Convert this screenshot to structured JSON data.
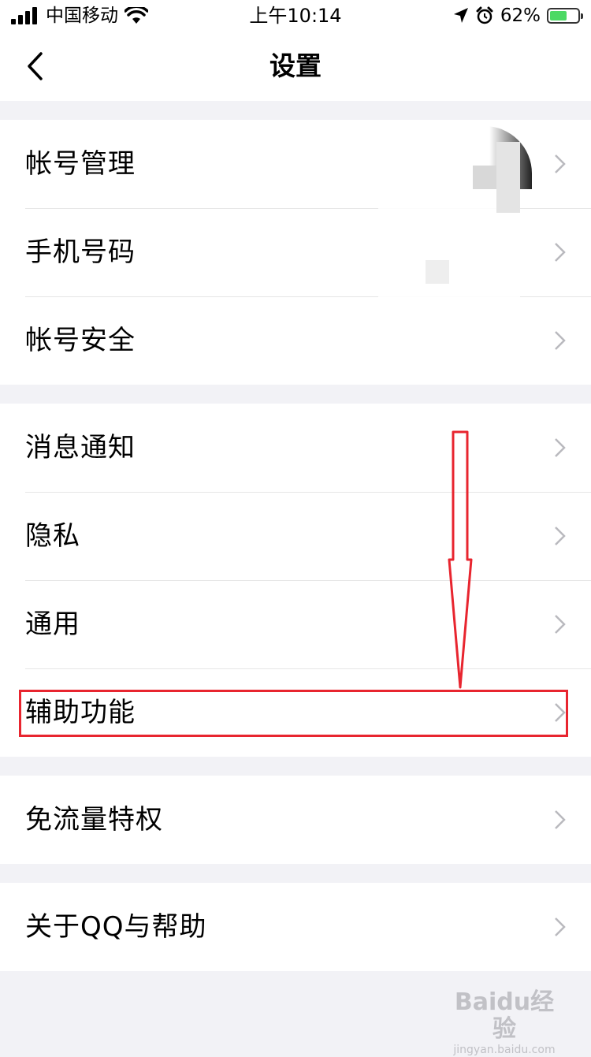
{
  "status_bar": {
    "carrier": "中国移动",
    "time": "上午10:14",
    "battery_percent": "62%",
    "battery_level": 0.62,
    "icons": [
      "signal-icon",
      "wifi-icon",
      "location-icon",
      "alarm-icon",
      "battery-charging-icon"
    ]
  },
  "nav": {
    "title": "设置",
    "back_icon": "chevron-left-icon"
  },
  "groups": [
    {
      "items": [
        {
          "label": "帐号管理"
        },
        {
          "label": "手机号码"
        },
        {
          "label": "帐号安全"
        }
      ]
    },
    {
      "items": [
        {
          "label": "消息通知"
        },
        {
          "label": "隐私"
        },
        {
          "label": "通用"
        },
        {
          "label": "辅助功能"
        }
      ]
    },
    {
      "items": [
        {
          "label": "免流量特权"
        }
      ]
    },
    {
      "items": [
        {
          "label": "关于QQ与帮助"
        }
      ]
    }
  ],
  "annotation": {
    "highlighted_item": "辅助功能",
    "color": "#e8252f"
  },
  "watermark": {
    "logo": "Baidu经验",
    "url": "jingyan.baidu.com"
  },
  "colors": {
    "background": "#f2f2f6",
    "cell": "#ffffff",
    "chevron": "#b9b9be",
    "separator": "#e6e6e6"
  }
}
